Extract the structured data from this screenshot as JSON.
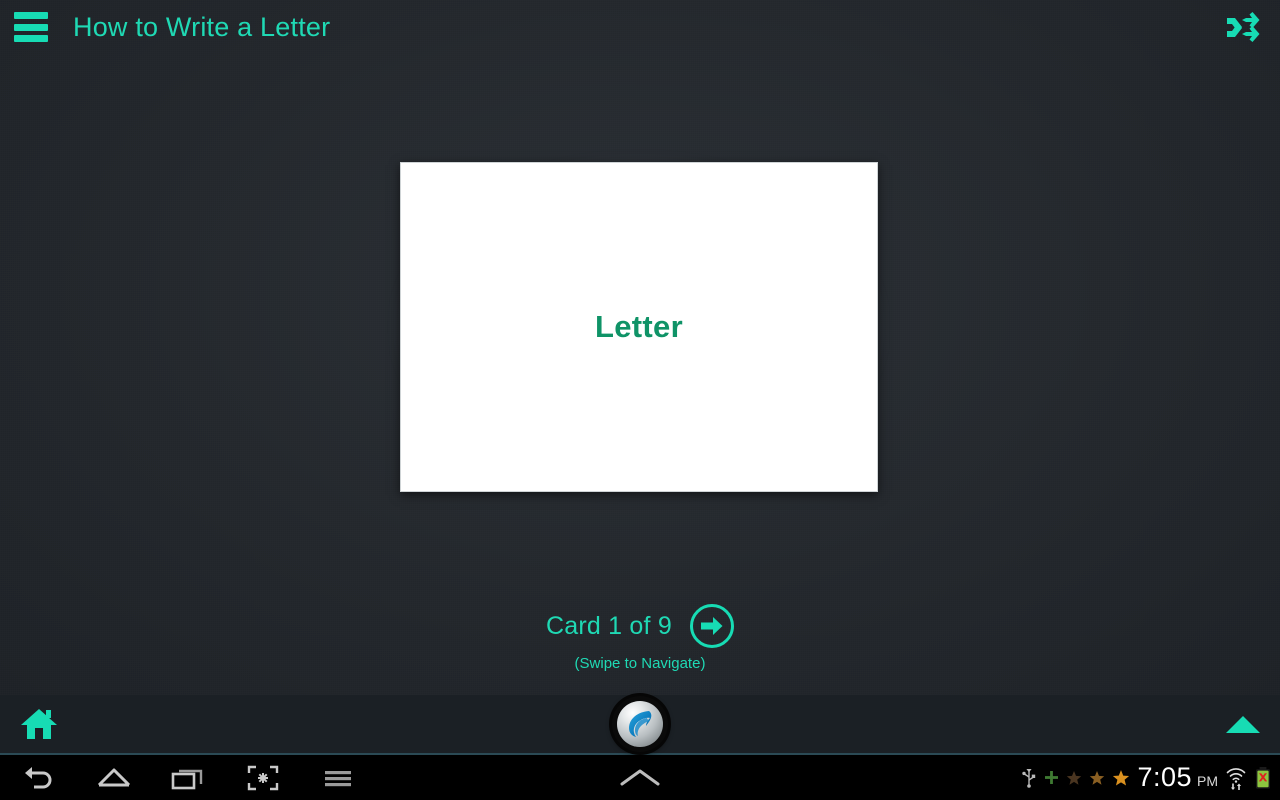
{
  "header": {
    "title": "How to Write a Letter",
    "menu_icon": "hamburger-menu-icon",
    "shuffle_icon": "shuffle-icon",
    "accent_color": "#1fd9b4"
  },
  "card": {
    "text": "Letter",
    "text_color": "#0f9367",
    "background_color": "#ffffff"
  },
  "navigation": {
    "counter": "Card 1 of 9",
    "current_card": 1,
    "total_cards": 9,
    "next_icon": "arrow-right-circle-icon",
    "swipe_hint": "(Swipe to Navigate)"
  },
  "app_bottom_bar": {
    "home_icon": "home-icon",
    "collapse_icon": "triangle-up-icon",
    "browser_orb_icon": "dolphin-browser-logo-icon",
    "background_color": "#1b2025"
  },
  "system_nav": {
    "back_icon": "back-arrow-icon",
    "home_icon": "home-outline-icon",
    "recents_icon": "recent-apps-icon",
    "capture_icon": "screenshot-capture-icon",
    "menu_icon": "menu-lines-icon",
    "expand_icon": "chevron-up-icon"
  },
  "status_tray": {
    "usb_icon": "usb-icon",
    "plus_icon": "plus-icon",
    "stars": [
      {
        "name": "star-icon-dim",
        "color": "#4a3520"
      },
      {
        "name": "star-icon-medium",
        "color": "#8a5f22"
      },
      {
        "name": "star-icon-bright",
        "color": "#d9901f"
      }
    ],
    "time": "7:05",
    "ampm": "PM",
    "wifi_icon": "wifi-data-icon",
    "battery_icon": "battery-error-icon"
  },
  "theme": {
    "background_color": "#24282d",
    "accent_teal": "#17dcb4",
    "system_bar_color": "#000000"
  }
}
